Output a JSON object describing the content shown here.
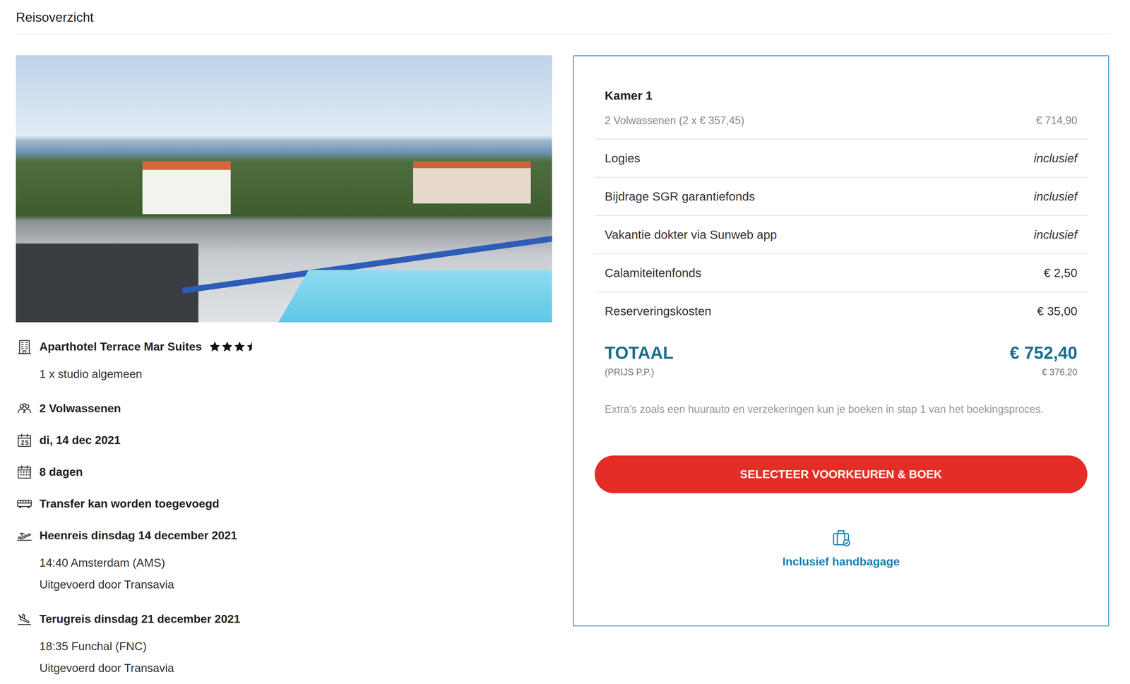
{
  "page": {
    "title": "Reisoverzicht"
  },
  "hotel": {
    "name": "Aparthotel Terrace Mar Suites",
    "stars": 3.5,
    "room": "1 x studio algemeen"
  },
  "details": [
    {
      "kind": "travelers",
      "text": "2 Volwassenen"
    },
    {
      "kind": "date",
      "text": "di, 14 dec 2021"
    },
    {
      "kind": "duration",
      "text": "8 dagen"
    },
    {
      "kind": "transfer",
      "text": "Transfer kan worden toegevoegd"
    }
  ],
  "flights": [
    {
      "kind": "departure",
      "title": "Heenreis dinsdag 14 december 2021",
      "lines": [
        "14:40 Amsterdam (AMS)",
        "Uitgevoerd door Transavia"
      ]
    },
    {
      "kind": "return",
      "title": "Terugreis dinsdag 21 december 2021",
      "lines": [
        "18:35 Funchal (FNC)",
        "Uitgevoerd door Transavia"
      ]
    }
  ],
  "summary": {
    "room": "Kamer 1",
    "travelers": {
      "label": "2 Volwassenen (2 x € 357,45)",
      "value": "€ 714,90"
    },
    "rows": [
      {
        "label": "Logies",
        "value": "inclusief",
        "kind": "included"
      },
      {
        "label": "Bijdrage SGR garantiefonds",
        "value": "inclusief",
        "kind": "included"
      },
      {
        "label": "Vakantie dokter via Sunweb app",
        "value": "inclusief",
        "kind": "included"
      },
      {
        "label": "Calamiteitenfonds",
        "value": "€ 2,50",
        "kind": "price"
      },
      {
        "label": "Reserveringskosten",
        "value": "€ 35,00",
        "kind": "price"
      }
    ],
    "total": {
      "label": "TOTAAL",
      "value": "€ 752,40",
      "sub_label": "(PRIJS P.P.)",
      "sub_value": "€ 376,20"
    },
    "note": "Extra's zoals een huurauto en verzekeringen kun je boeken in stap 1 van het boekingsproces.",
    "button": "SELECTEER VOORKEUREN & BOEK",
    "baggage": "Inclusief handbagage"
  }
}
